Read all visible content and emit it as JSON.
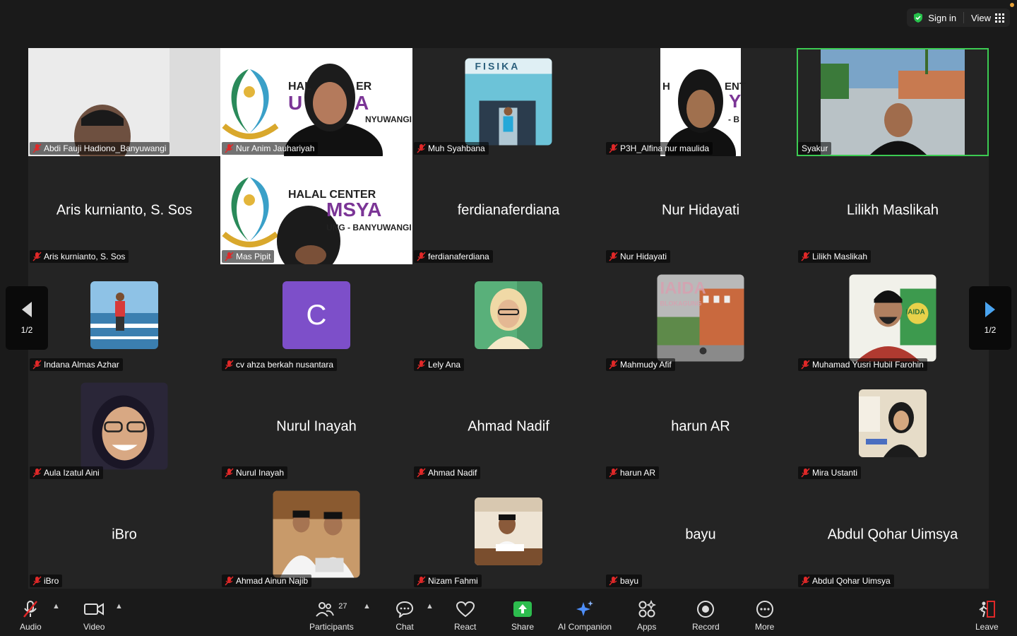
{
  "header": {
    "sign_in": "Sign in",
    "view": "View"
  },
  "pager": {
    "left": "1/2",
    "right": "1/2"
  },
  "tiles": [
    {
      "name": "Abdi Fauji Hadiono_Banyuwangi"
    },
    {
      "name": "Nur Anim Jauhariyah",
      "bg_text_1": "HAL",
      "bg_text_2": "ER",
      "bg_text_3": "U",
      "bg_text_4": "A",
      "bg_text_5": "NYUWANGI"
    },
    {
      "name": "Muh Syahbana",
      "bg_text_1": "FISIKA"
    },
    {
      "name": "P3H_Alfina nur maulida",
      "bg_text_1": "H",
      "bg_text_2": "ENT",
      "bg_text_3": "Y",
      "bg_text_4": "- B"
    },
    {
      "name": "Syakur"
    },
    {
      "name": "Aris kurnianto, S. Sos",
      "display": "Aris kurnianto, S. Sos"
    },
    {
      "name": "Mas Pipit",
      "bg_text_1": "HALAL CENTER",
      "bg_text_2": "MSYA",
      "bg_text_3": "UNG - BANYUWANGI"
    },
    {
      "name": "ferdianaferdiana",
      "display": "ferdianaferdiana"
    },
    {
      "name": "Nur Hidayati",
      "display": "Nur Hidayati"
    },
    {
      "name": "Lilikh Maslikah",
      "display": "Lilikh Maslikah"
    },
    {
      "name": "Indana Almas Azhar"
    },
    {
      "name": "cv ahza berkah nusantara",
      "initial": "C"
    },
    {
      "name": "Lely Ana"
    },
    {
      "name": "Mahmudy Afif",
      "bg_text_1": "IAIDA",
      "bg_text_2": "BLOKAGUNG"
    },
    {
      "name": "Muhamad Yusri Hubil Farohin",
      "bg_text_1": "IAIDA"
    },
    {
      "name": "Aula Izatul Aini"
    },
    {
      "name": "Nurul Inayah",
      "display": "Nurul Inayah"
    },
    {
      "name": "Ahmad Nadif",
      "display": "Ahmad Nadif"
    },
    {
      "name": "harun AR",
      "display": "harun AR"
    },
    {
      "name": "Mira Ustanti"
    },
    {
      "name": "iBro",
      "display": "iBro"
    },
    {
      "name": "Ahmad Ainun Najib"
    },
    {
      "name": "Nizam Fahmi"
    },
    {
      "name": "bayu",
      "display": "bayu"
    },
    {
      "name": "Abdul Qohar Uimsya",
      "display": "Abdul Qohar Uimsya"
    }
  ],
  "toolbar": {
    "audio": "Audio",
    "video": "Video",
    "participants": "Participants",
    "participants_count": "27",
    "chat": "Chat",
    "react": "React",
    "share": "Share",
    "ai_companion": "AI Companion",
    "apps": "Apps",
    "record": "Record",
    "more": "More",
    "leave": "Leave"
  },
  "colors": {
    "active_speaker": "#3ccb52",
    "mute": "#e02828",
    "share": "#2dbd4e",
    "avatar_c": "#7d4fc9"
  }
}
